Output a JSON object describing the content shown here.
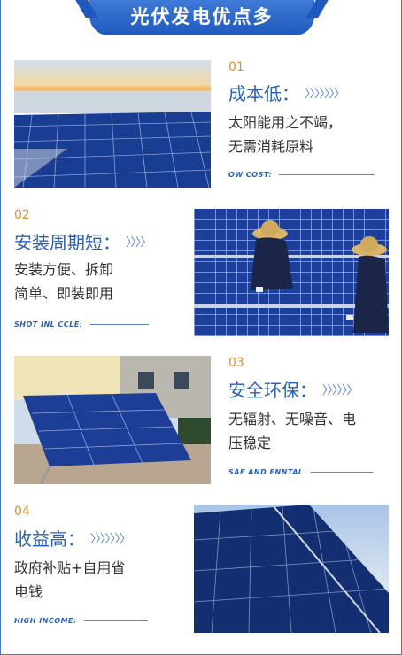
{
  "header": {
    "title": "光伏发电优点多"
  },
  "items": [
    {
      "number": "01",
      "title": "成本低：",
      "arrows": "〉〉〉〉〉〉〉",
      "description_lines": [
        "太阳能用之不竭，",
        "无需消耗原料"
      ],
      "subtitle": "OW COST:",
      "photo": "rooftop-solar-array-at-sunset"
    },
    {
      "number": "02",
      "title": "安装周期短：",
      "arrows": "〉〉〉〉",
      "description_lines": [
        "安装方便、拆卸",
        "简单、即装即用"
      ],
      "subtitle": "SHOT INL CCLE:",
      "photo": "workers-installing-solar-panels"
    },
    {
      "number": "03",
      "title": "安全环保：",
      "arrows": "〉〉〉〉〉〉",
      "description_lines": [
        "无辐射、无噪音、电",
        "压稳定"
      ],
      "subtitle": "SAF AND ENNTAL",
      "photo": "residential-solar-panels"
    },
    {
      "number": "04",
      "title": "收益高：",
      "arrows": "〉〉〉〉〉〉〉",
      "description_lines": [
        "政府补贴+自用省",
        "电钱"
      ],
      "subtitle": "HIGH INCOME:",
      "photo": "ground-mounted-solar-panels"
    }
  ],
  "colors": {
    "accent": "#2a5fb8",
    "number": "#e0912c",
    "banner": "#1f59bd"
  }
}
